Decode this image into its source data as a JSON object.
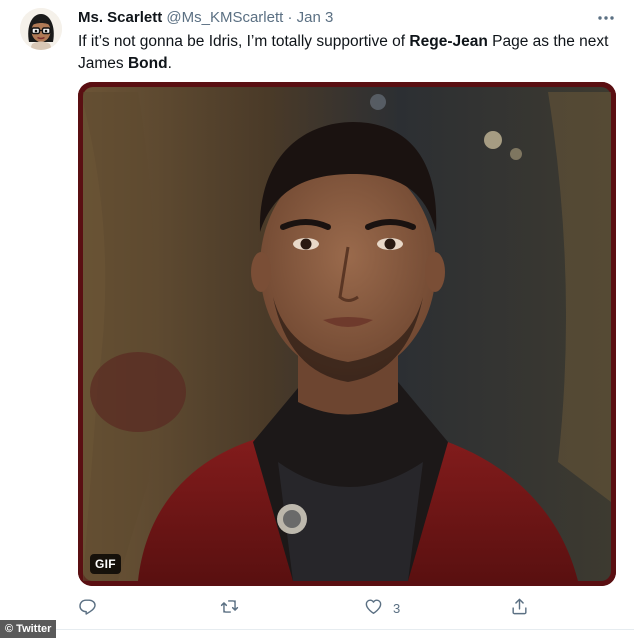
{
  "tweet": {
    "author_name": "Ms. Scarlett",
    "handle": "@Ms_KMScarlett",
    "separator": "·",
    "date": "Jan 3",
    "text_parts": {
      "p1": "If it’s not gonna be Idris, I’m totally supportive of ",
      "b1": "Rege-Jean",
      "p2": " Page as the next James ",
      "b2": "Bond",
      "p3": "."
    },
    "media": {
      "badge": "GIF"
    },
    "actions": {
      "reply_count": "",
      "retweet_count": "",
      "like_count": "3",
      "share_count": ""
    }
  },
  "watermark": "© Twitter",
  "icons": {
    "more": "more-horizontal-icon",
    "reply": "reply-icon",
    "retweet": "retweet-icon",
    "like": "heart-icon",
    "share": "share-icon"
  },
  "colors": {
    "secondary_text": "#5b7083",
    "media_border": "#5a0f12"
  }
}
